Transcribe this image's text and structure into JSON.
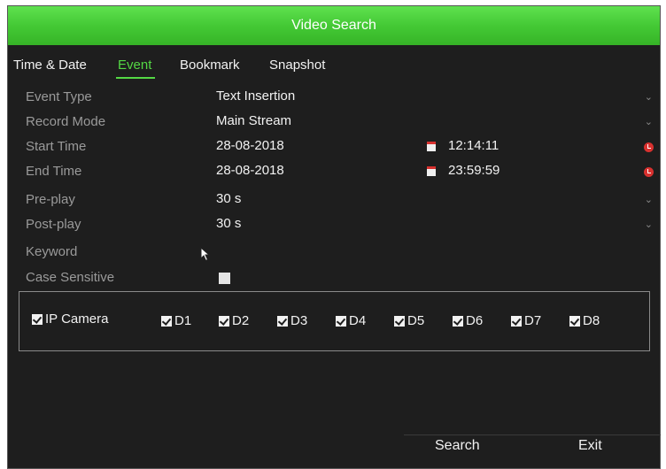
{
  "window": {
    "title": "Video Search"
  },
  "tabs": [
    {
      "label": "Time & Date",
      "active": false
    },
    {
      "label": "Event",
      "active": true
    },
    {
      "label": "Bookmark",
      "active": false
    },
    {
      "label": "Snapshot",
      "active": false
    }
  ],
  "form": {
    "event_type": {
      "label": "Event Type",
      "value": "Text Insertion"
    },
    "record_mode": {
      "label": "Record Mode",
      "value": "Main Stream"
    },
    "start_time": {
      "label": "Start Time",
      "date": "28-08-2018",
      "time": "12:14:11"
    },
    "end_time": {
      "label": "End Time",
      "date": "28-08-2018",
      "time": "23:59:59"
    },
    "pre_play": {
      "label": "Pre-play",
      "value": "30 s"
    },
    "post_play": {
      "label": "Post-play",
      "value": "30 s"
    },
    "keyword": {
      "label": "Keyword",
      "value": ""
    },
    "case_sensitive": {
      "label": "Case Sensitive",
      "checked": false
    }
  },
  "cameras": {
    "group_label": "IP Camera",
    "group_checked": true,
    "items": [
      {
        "label": "D1",
        "checked": true
      },
      {
        "label": "D2",
        "checked": true
      },
      {
        "label": "D3",
        "checked": true
      },
      {
        "label": "D4",
        "checked": true
      },
      {
        "label": "D5",
        "checked": true
      },
      {
        "label": "D6",
        "checked": true
      },
      {
        "label": "D7",
        "checked": true
      },
      {
        "label": "D8",
        "checked": true
      }
    ]
  },
  "buttons": {
    "search": "Search",
    "exit": "Exit"
  },
  "icons": {
    "date": "calendar-icon",
    "time": "clock-icon",
    "dropdown": "chevron-down-icon"
  },
  "colors": {
    "title_bar": "#44c935",
    "active_tab": "#54d844",
    "background": "#1e1e1e",
    "icon_red": "#d8312f"
  }
}
